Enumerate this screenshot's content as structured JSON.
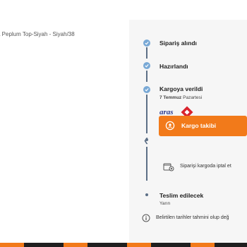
{
  "product": {
    "name_line": "a Peplum Top-Siyah - Siyah/38"
  },
  "timeline": {
    "steps": [
      {
        "label": "Sipariş alındı"
      },
      {
        "label": "Hazırlandı"
      },
      {
        "label": "Kargoya verildi",
        "date_bold": "7 Temmuz",
        "date_rest": " Pazartesi"
      }
    ],
    "carrier_logo": "aras-kargo-logo",
    "track_button_label": "Kargo takibi",
    "cancel_text": "Siparişi kargoda iptal et",
    "delivery": {
      "label": "Teslim edilecek",
      "sub": "Yarın"
    },
    "info_text": "Belirtilen tarihler tahmini olup değ"
  },
  "colors": {
    "accent": "#f27a1a",
    "done_icon": "#79a9d6",
    "line": "#5c6f86"
  }
}
